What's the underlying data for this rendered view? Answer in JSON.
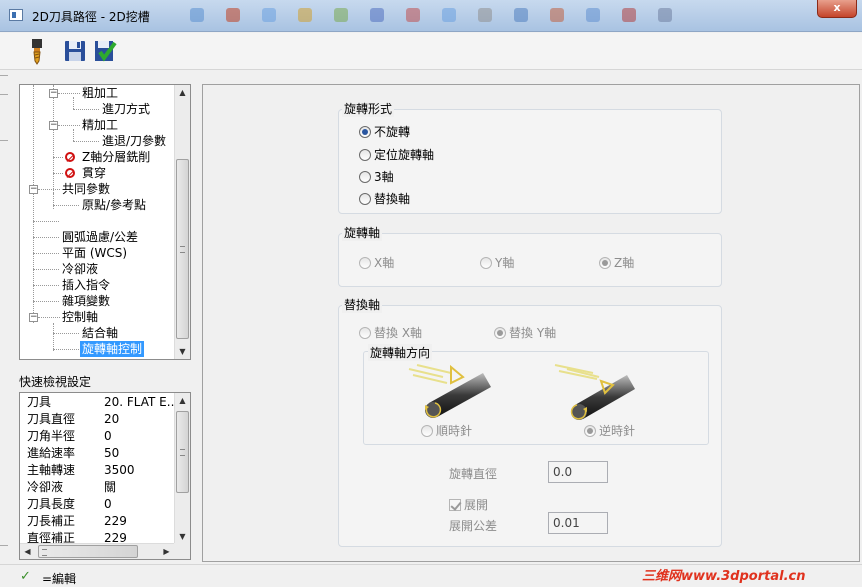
{
  "window": {
    "title": "2D刀具路徑 - 2D挖槽",
    "close_label": "x"
  },
  "toolbar": {
    "items": [
      "tool-icon",
      "save-icon",
      "confirm-icon"
    ]
  },
  "tree": {
    "items": [
      {
        "label": "粗加工"
      },
      {
        "label": "進刀方式"
      },
      {
        "label": "精加工"
      },
      {
        "label": "進退/刀參數"
      },
      {
        "label": "Z軸分層銑削"
      },
      {
        "label": "貫穿"
      },
      {
        "label": "共同參數"
      },
      {
        "label": "原點/參考點"
      },
      {
        "label": "圓弧過慮/公差"
      },
      {
        "label": "平面 (WCS)"
      },
      {
        "label": "冷卻液"
      },
      {
        "label": "插入指令"
      },
      {
        "label": "雜項變數"
      },
      {
        "label": "控制軸"
      },
      {
        "label": "結合軸"
      },
      {
        "label": "旋轉軸控制"
      }
    ]
  },
  "quick_view": {
    "title": "快速檢視設定",
    "rows": [
      {
        "label": "刀具",
        "value": "20. FLAT E..."
      },
      {
        "label": "刀具直徑",
        "value": "20"
      },
      {
        "label": "刀角半徑",
        "value": "0"
      },
      {
        "label": "進給速率",
        "value": "50"
      },
      {
        "label": "主軸轉速",
        "value": "3500"
      },
      {
        "label": "冷卻液",
        "value": "關"
      },
      {
        "label": "刀具長度",
        "value": "0"
      },
      {
        "label": "刀長補正",
        "value": "229"
      },
      {
        "label": "直徑補正",
        "value": "229"
      }
    ]
  },
  "rotation_type": {
    "title": "旋轉形式",
    "options": [
      "不旋轉",
      "定位旋轉軸",
      "3軸",
      "替換軸"
    ],
    "selected": "不旋轉"
  },
  "rotation_axis": {
    "title": "旋轉軸",
    "options": [
      "X軸",
      "Y軸",
      "Z軸"
    ],
    "selected": "Z軸"
  },
  "replace_axis": {
    "title": "替換軸",
    "options": [
      "替換 X軸",
      "替換 Y軸"
    ],
    "selected": "替換 Y軸",
    "direction": {
      "title": "旋轉軸方向",
      "options": [
        "順時針",
        "逆時針"
      ],
      "selected": "逆時針"
    },
    "rotation_diameter": {
      "label": "旋轉直徑",
      "value": "0.0"
    },
    "unwrap": {
      "label": "展開",
      "checked": true
    },
    "unwrap_tolerance": {
      "label": "展開公差",
      "value": "0.01"
    }
  },
  "status": {
    "text": "=編輯"
  },
  "watermark": "三维网www.3dportal.cn"
}
